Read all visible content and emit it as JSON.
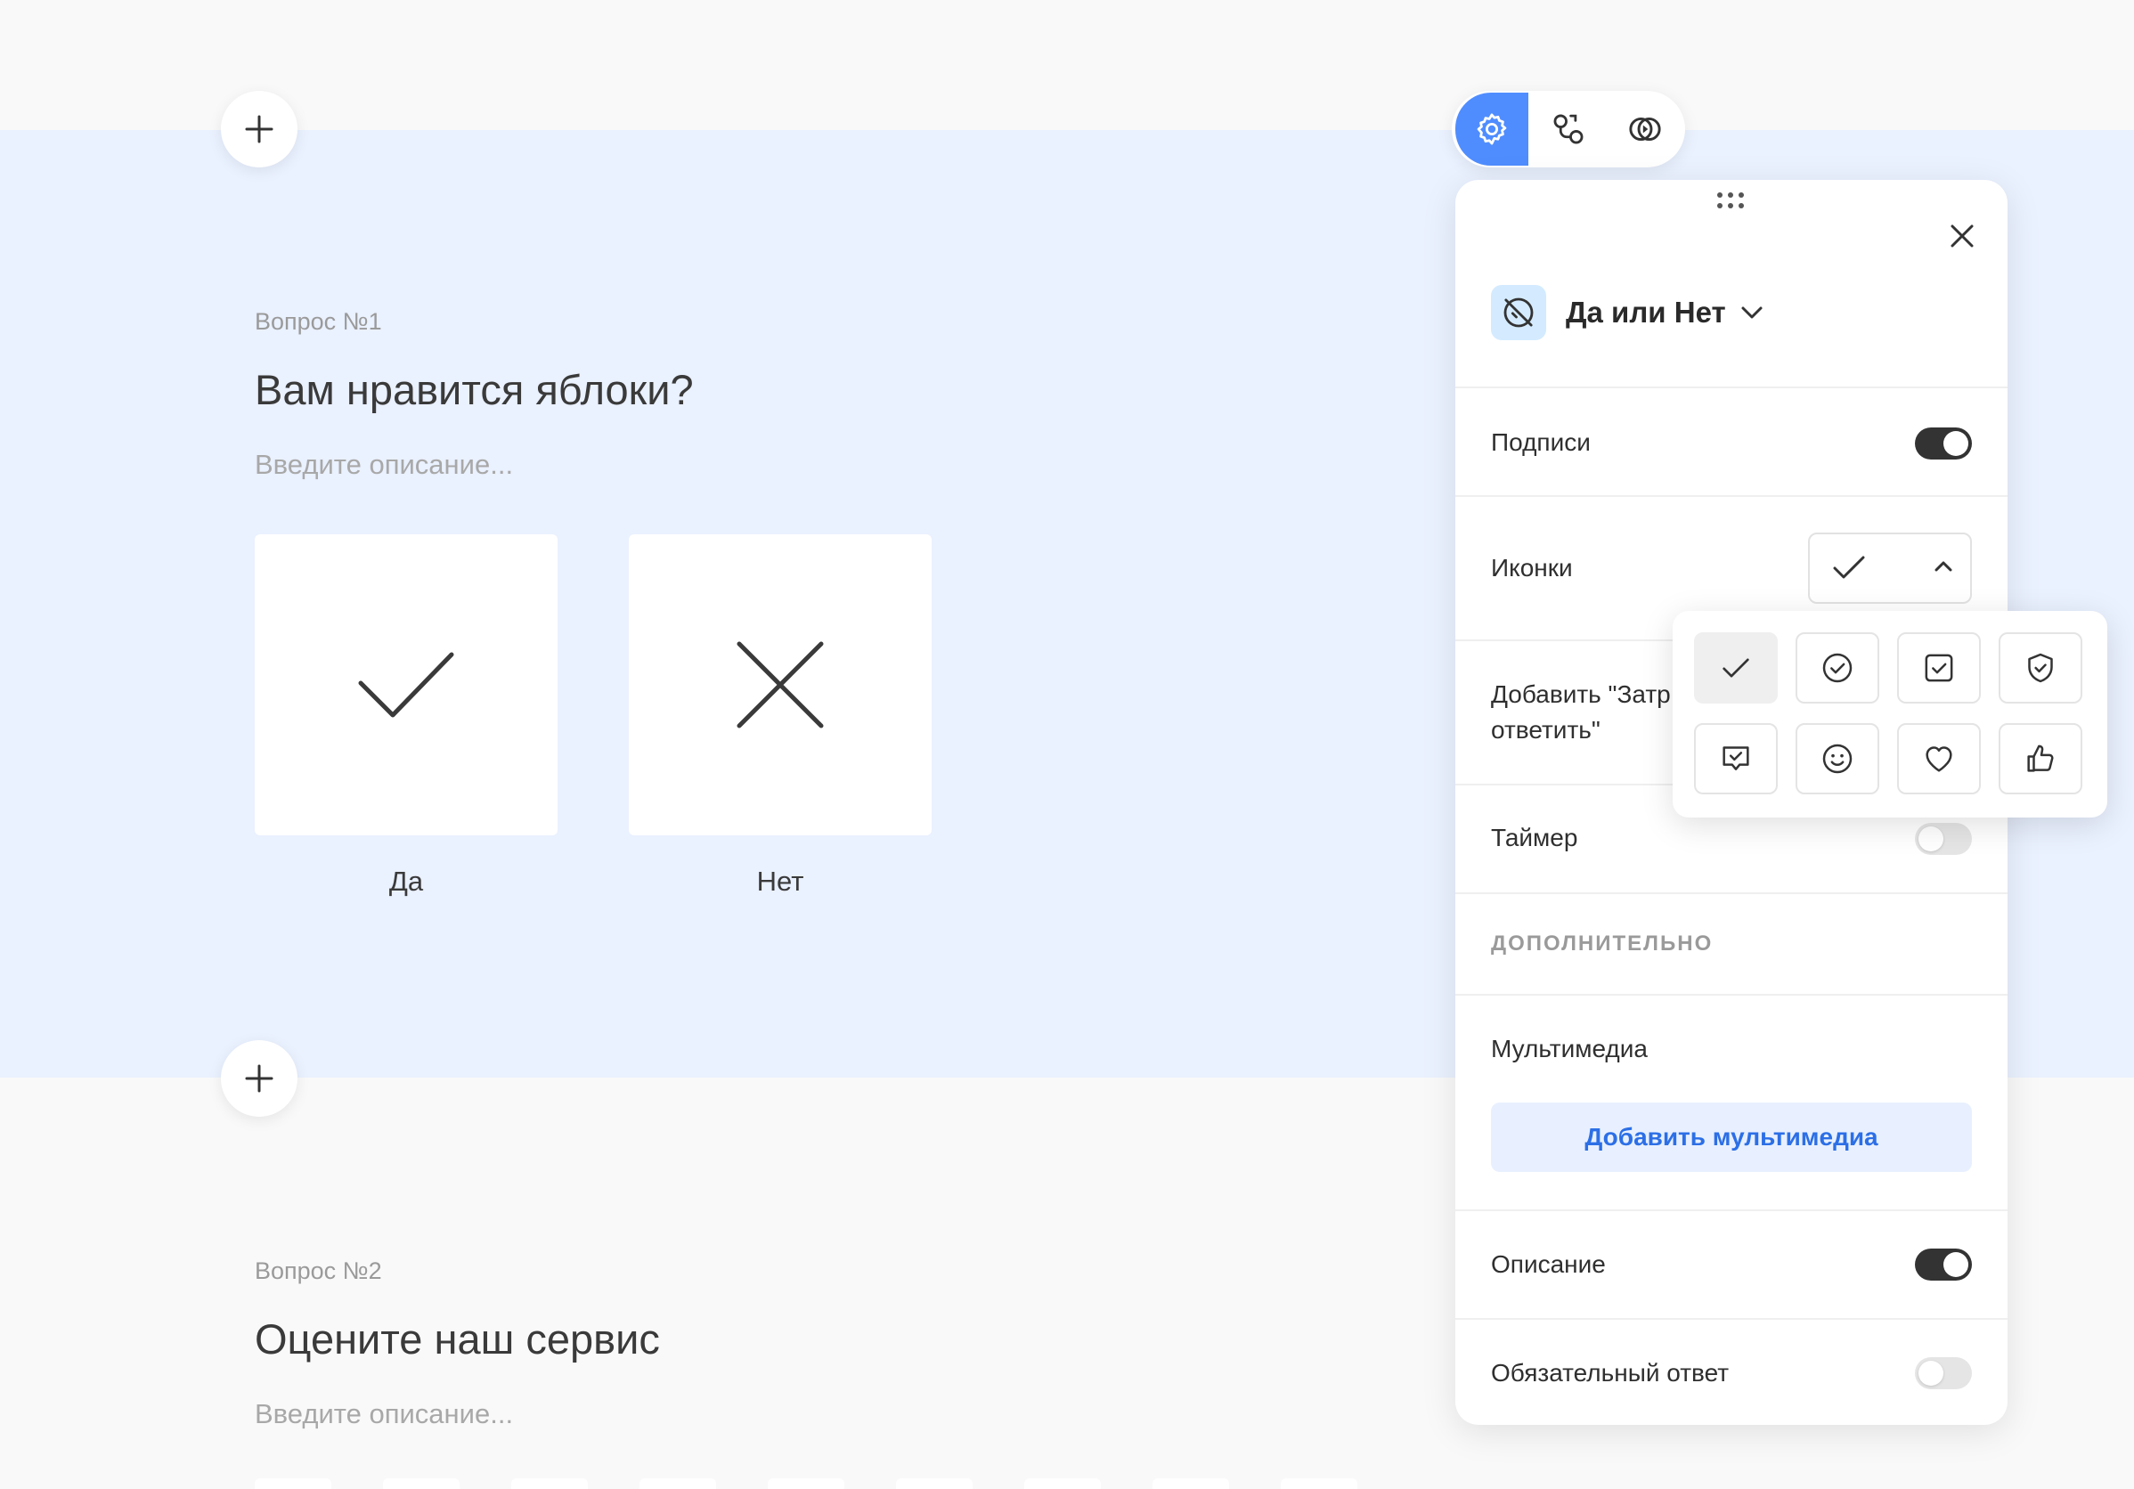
{
  "question1": {
    "label": "Вопрос №1",
    "title": "Вам нравится яблоки?",
    "description_placeholder": "Введите описание...",
    "answers": [
      {
        "label": "Да",
        "icon": "check-icon"
      },
      {
        "label": "Нет",
        "icon": "cross-icon"
      }
    ]
  },
  "question2": {
    "label": "Вопрос №2",
    "title": "Оцените наш сервис",
    "description_placeholder": "Введите описание..."
  },
  "toolbar": {
    "buttons": [
      {
        "icon": "gear-icon",
        "active": true
      },
      {
        "icon": "logic-icon",
        "active": false
      },
      {
        "icon": "preview-icon",
        "active": false
      }
    ]
  },
  "panel": {
    "question_type": "Да или Нет",
    "rows": {
      "captions": {
        "label": "Подписи",
        "on": true
      },
      "icons": {
        "label": "Иконки",
        "selected": "check-icon"
      },
      "skip": {
        "label_line1": "Добавить \"Затр",
        "label_line2": "ответить\""
      },
      "timer": {
        "label": "Таймер",
        "on": false
      },
      "additional_header": "ДОПОЛНИТЕЛЬНО",
      "multimedia": {
        "label": "Мультимедиа",
        "button": "Добавить мультимедиа"
      },
      "description": {
        "label": "Описание",
        "on": true
      },
      "required": {
        "label": "Обязательный ответ",
        "on": false
      }
    }
  },
  "icon_picker": {
    "options": [
      "check-icon",
      "check-circle-icon",
      "check-square-icon",
      "check-shield-icon",
      "check-message-icon",
      "smile-icon",
      "heart-icon",
      "thumbs-up-icon"
    ],
    "selected_index": 0
  },
  "colors": {
    "accent": "#4f8dff",
    "question_band": "#eaf1ff",
    "media_button_bg": "#e8f0ff",
    "media_button_text": "#2c6fe6",
    "type_icon_bg": "#d4ebff"
  }
}
